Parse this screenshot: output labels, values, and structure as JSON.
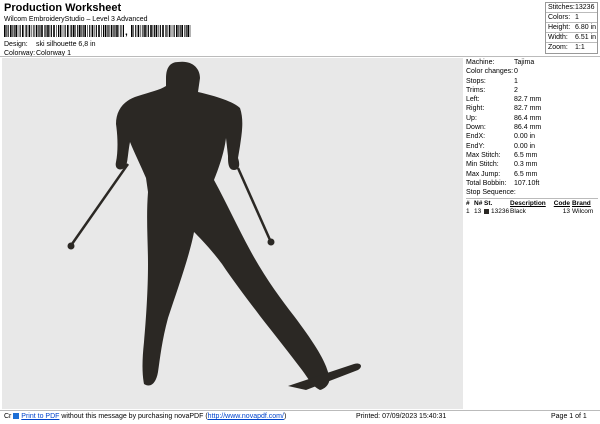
{
  "header": {
    "title": "Production Worksheet",
    "subtitle": "Wilcom EmbroideryStudio – Level 3 Advanced",
    "barcode_comma": ","
  },
  "design_meta": {
    "design_label": "Design:",
    "design_value": "ski silhouette 6,8 in",
    "colorway_label": "Colorway:",
    "colorway_value": "Colorway 1"
  },
  "stats": [
    {
      "label": "Stitches:",
      "value": "13236"
    },
    {
      "label": "Colors:",
      "value": "1"
    },
    {
      "label": "Height:",
      "value": "6.80 in"
    },
    {
      "label": "Width:",
      "value": "6.51 in"
    },
    {
      "label": "Zoom:",
      "value": "1:1"
    }
  ],
  "machine_info": [
    {
      "label": "Machine:",
      "value": "Tajima"
    },
    {
      "label": "Color changes:",
      "value": "0"
    },
    {
      "label": "Stops:",
      "value": "1"
    },
    {
      "label": "Trims:",
      "value": "2"
    },
    {
      "label": "Left:",
      "value": "82.7 mm"
    },
    {
      "label": "Right:",
      "value": "82.7 mm"
    },
    {
      "label": "Up:",
      "value": "86.4 mm"
    },
    {
      "label": "Down:",
      "value": "86.4 mm"
    },
    {
      "label": "EndX:",
      "value": "0.00 in"
    },
    {
      "label": "EndY:",
      "value": "0.00 in"
    },
    {
      "label": "Max Stitch:",
      "value": "6.5 mm"
    },
    {
      "label": "Min Stitch:",
      "value": "0.3 mm"
    },
    {
      "label": "Max Jump:",
      "value": "6.5 mm"
    },
    {
      "label": "Total Bobbin:",
      "value": "107.10ft"
    }
  ],
  "stop_sequence": {
    "label": "Stop Sequence:",
    "headers": {
      "num": "#",
      "n": "N#",
      "st": "St.",
      "desc": "Description",
      "code": "Code",
      "brand": "Brand"
    },
    "rows": [
      {
        "num": "1",
        "n": "13",
        "st": "13236",
        "desc": "Black",
        "code": "13",
        "brand": "Wilcom",
        "color": "#2b2824"
      }
    ]
  },
  "footer": {
    "prefix": "Cr",
    "link1": "Print to PDF",
    "text1": " without this message by purchasing novaPDF (",
    "link2": "http://www.novapdf.com/",
    "text2": ")",
    "printed": "Printed: 07/09/2023 15:40:31",
    "page": "Page 1 of 1"
  },
  "colors": {
    "silhouette": "#2b2824",
    "canvas": "#e8e8e8",
    "link": "#0044cc"
  }
}
